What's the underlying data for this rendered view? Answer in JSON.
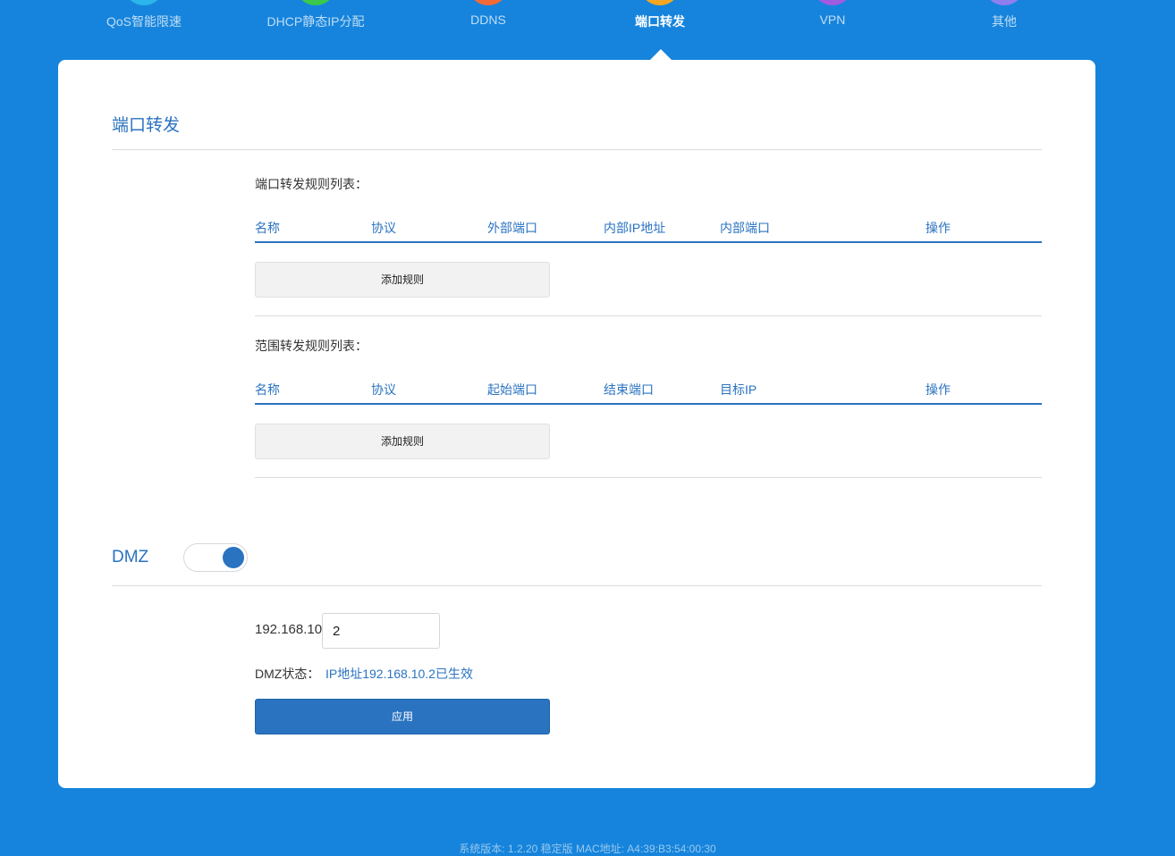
{
  "nav": {
    "items": [
      {
        "label": "QoS智能限速",
        "color": "#2bb5e8"
      },
      {
        "label": "DHCP静态IP分配",
        "color": "#3cc84a"
      },
      {
        "label": "DDNS",
        "color": "#f26a35"
      },
      {
        "label": "端口转发",
        "color": "#f5a623"
      },
      {
        "label": "VPN",
        "color": "#a05be0"
      },
      {
        "label": "其他",
        "color": "#8f7ef0"
      }
    ],
    "active_index": 3
  },
  "port_forward": {
    "title": "端口转发",
    "port_list": {
      "title": "端口转发规则列表：",
      "columns": [
        "名称",
        "协议",
        "外部端口",
        "内部IP地址",
        "内部端口",
        "操作"
      ],
      "add_label": "添加规则"
    },
    "range_list": {
      "title": "范围转发规则列表：",
      "columns": [
        "名称",
        "协议",
        "起始端口",
        "结束端口",
        "目标IP",
        "操作"
      ],
      "add_label": "添加规则"
    }
  },
  "dmz": {
    "title": "DMZ",
    "enabled": true,
    "ip_prefix": "192.168.10.",
    "ip_last": "2",
    "status_label": "DMZ状态：",
    "status_value": "IP地址192.168.10.2已生效",
    "apply_label": "应用"
  },
  "footer": {
    "text": "系统版本: 1.2.20 稳定版  MAC地址: A4:39:B3:54:00:30"
  },
  "colors": {
    "background": "#1684dc",
    "accent": "#2a73c0"
  }
}
